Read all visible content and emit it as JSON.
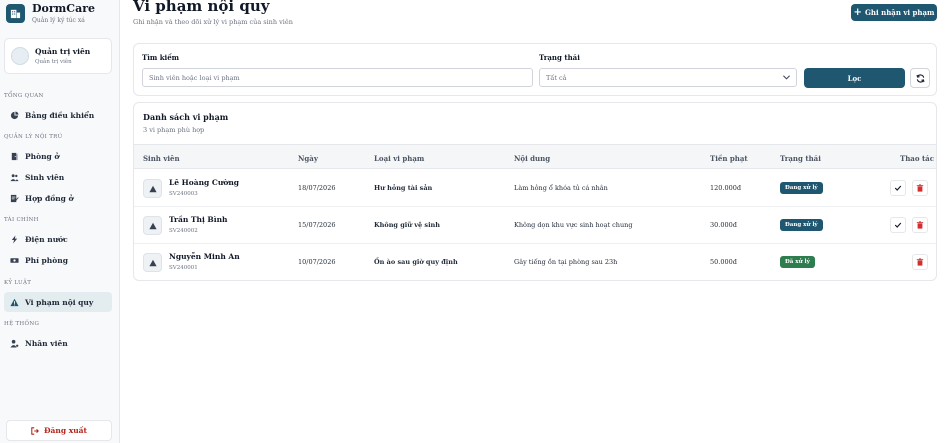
{
  "app": {
    "name": "DormCare",
    "tagline": "Quản lý ký túc xá"
  },
  "user": {
    "name": "Quản trị viên",
    "role": "Quản trị viên"
  },
  "nav": {
    "sections": [
      {
        "label": "TỔNG QUAN"
      },
      {
        "label": "QUẢN LÝ NỘI TRÚ"
      },
      {
        "label": "TÀI CHÍNH"
      },
      {
        "label": "KỶ LUẬT"
      },
      {
        "label": "HỆ THỐNG"
      }
    ],
    "items": [
      {
        "label": "Bảng điều khiển",
        "icon": "dashboard-icon"
      },
      {
        "label": "Phòng ở",
        "icon": "door-icon"
      },
      {
        "label": "Sinh viên",
        "icon": "users-icon"
      },
      {
        "label": "Hợp đồng ở",
        "icon": "contract-icon"
      },
      {
        "label": "Điện nước",
        "icon": "bolt-icon"
      },
      {
        "label": "Phí phòng",
        "icon": "money-icon"
      },
      {
        "label": "Vi phạm nội quy",
        "icon": "warning-icon",
        "active": true
      },
      {
        "label": "Nhân viên",
        "icon": "staff-icon"
      }
    ],
    "logout_label": "Đăng xuất"
  },
  "header": {
    "title": "Vi phạm nội quy",
    "subtitle": "Ghi nhận và theo dõi xử lý vi phạm của sinh viên",
    "add_label": "Ghi nhận vi phạm"
  },
  "filter": {
    "search_label": "Tìm kiếm",
    "search_placeholder": "Sinh viên hoặc loại vi phạm",
    "status_label": "Trạng thái",
    "status_value": "Tất cả",
    "filter_label": "Lọc"
  },
  "list": {
    "title": "Danh sách vi phạm",
    "count_text": "3 vi phạm phù hợp",
    "columns": {
      "student": "Sinh viên",
      "date": "Ngày",
      "type": "Loại vi phạm",
      "content": "Nội dung",
      "fine": "Tiền phạt",
      "status": "Trạng thái",
      "actions": "Thao tác"
    },
    "rows": [
      {
        "name": "Lê Hoàng Cường",
        "id": "SV240003",
        "date": "18/07/2026",
        "type": "Hư hỏng tài sản",
        "content": "Làm hỏng ổ khóa tủ cá nhân",
        "fine": "120.000đ",
        "status": "Đang xử lý",
        "status_color": "#1f5670",
        "resolved": false
      },
      {
        "name": "Trần Thị Bình",
        "id": "SV240002",
        "date": "15/07/2026",
        "type": "Không giữ vệ sinh",
        "content": "Không dọn khu vực sinh hoạt chung",
        "fine": "30.000đ",
        "status": "Đang xử lý",
        "status_color": "#1f5670",
        "resolved": false
      },
      {
        "name": "Nguyễn Minh An",
        "id": "SV240001",
        "date": "10/07/2026",
        "type": "Ồn ào sau giờ quy định",
        "content": "Gây tiếng ồn tại phòng sau 23h",
        "fine": "50.000đ",
        "status": "Đã xử lý",
        "status_color": "#2e7d4f",
        "resolved": true
      }
    ]
  },
  "colors": {
    "primary": "#1f5670",
    "danger": "#d32f2f",
    "success": "#2e7d4f"
  }
}
